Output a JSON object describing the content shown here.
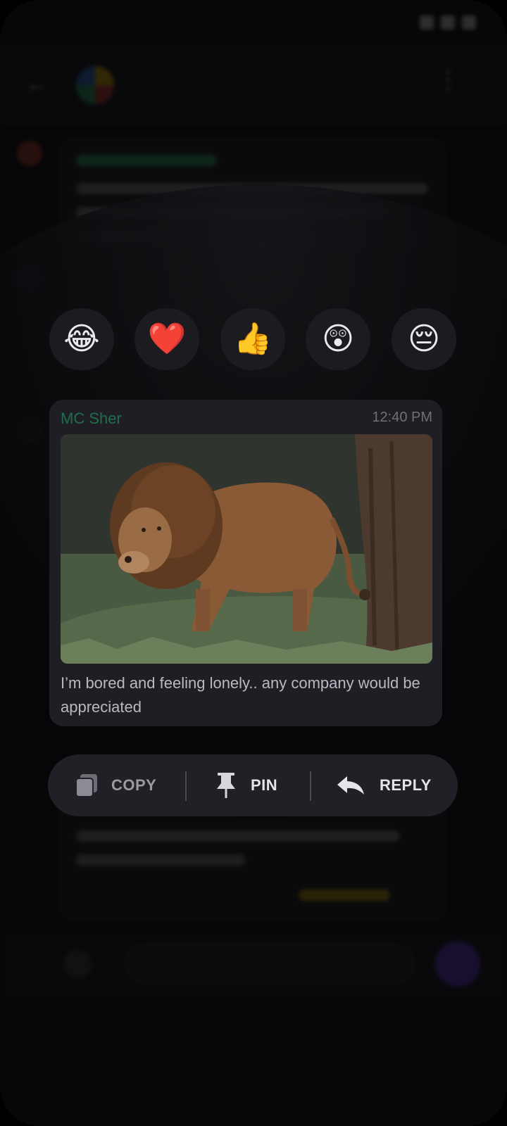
{
  "chat": {
    "title": "",
    "status_time": ""
  },
  "reactions": [
    {
      "emoji": "😂",
      "icon": "tears-of-joy-emoji"
    },
    {
      "emoji": "❤️",
      "icon": "heart-emoji"
    },
    {
      "emoji": "👍",
      "icon": "thumbs-up-emoji"
    },
    {
      "emoji": "😲",
      "icon": "astonished-emoji"
    },
    {
      "emoji": "😔",
      "icon": "pensive-emoji"
    }
  ],
  "message": {
    "author": "MC Sher",
    "time": "12:40 PM",
    "text": "I’m bored and feeling lonely.. any company would be appreciated",
    "image_icon": "lion-photo",
    "author_color": "#1f6e4c"
  },
  "actions": {
    "copy": {
      "label": "COPY",
      "icon": "copy-icon"
    },
    "pin": {
      "label": "PIN",
      "icon": "pin-icon"
    },
    "reply": {
      "label": "REPLY",
      "icon": "reply-arrow-icon"
    }
  },
  "colors": {
    "accent": "#6b3be0",
    "card": "#1e1e24",
    "action_bar": "#202026"
  }
}
